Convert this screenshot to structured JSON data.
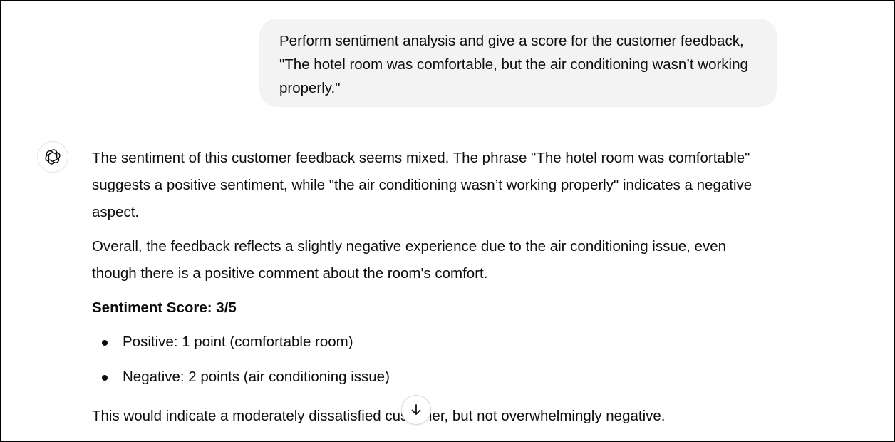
{
  "conversation": {
    "user_message": "Perform sentiment analysis and give a score for the customer feedback, \"The hotel room was comfortable, but the air conditioning wasn’t working properly.\"",
    "assistant": {
      "avatar_icon": "openai-logo-icon",
      "paragraph_1": "The sentiment of this customer feedback seems mixed. The phrase \"The hotel room was comfortable\" suggests a positive sentiment, while \"the air conditioning wasn’t working properly\" indicates a negative aspect.",
      "paragraph_2": "Overall, the feedback reflects a slightly negative experience due to the air conditioning issue, even though there is a positive comment about the room's comfort.",
      "score_label": "Sentiment Score: 3/5",
      "bullets": [
        "Positive: 1 point (comfortable room)",
        "Negative: 2 points (air conditioning issue)"
      ],
      "paragraph_3": "This would indicate a moderately dissatisfied customer, but not overwhelmingly negative."
    }
  },
  "scroll_button": {
    "icon": "arrow-down-icon"
  },
  "colors": {
    "user_bubble_bg": "#f3f3f3",
    "text": "#0d0d0d",
    "border": "#000000"
  }
}
